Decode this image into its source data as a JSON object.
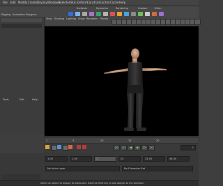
{
  "menubar": {
    "items": [
      "File",
      "Edit",
      "Modify",
      "Create",
      "Display",
      "Windows",
      "Skeleton",
      "Skin",
      "Deform",
      "Constrain",
      "Control",
      "Cache",
      "Help"
    ]
  },
  "shelf": {
    "tabs": [
      "Rigging",
      "Animation",
      "Polygons",
      "Surfaces",
      "Dynamics",
      "Rendering",
      "Custom",
      "XGen"
    ],
    "tool_colors": [
      "#2e6fd6",
      "#7ab3e6",
      "#a7a7a7",
      "#a870c8",
      "#3aa06a",
      "#b4b4b4",
      "#d9534f",
      "#e0a23b",
      "#4aa3df",
      "#8b8b8b",
      "#6bbf59",
      "#c9c9c9",
      "#d06c3a",
      "#9a6fd0"
    ]
  },
  "left_panel": {
    "labels": [
      "Tools",
      "Edit",
      "Help"
    ]
  },
  "viewport": {
    "panel_menu": [
      "View",
      "Shading",
      "Lighting",
      "Show",
      "Renderer",
      "Panels"
    ]
  },
  "timeline": {
    "current_frame": "1",
    "ticks": [
      "1",
      "5",
      "10",
      "15",
      "20"
    ],
    "start_field": "1.00",
    "end_field": "24.00"
  },
  "bottom_panel": {
    "row1": [
      "1.00",
      "1.00",
      "1",
      "24",
      "24.00",
      "48.00"
    ],
    "row2_label": "No Anim Layer",
    "row3_label": "No Character Set"
  },
  "status": {
    "help_text": "Select an object to display its attributes. Hold the Shift key to add objects to the selection."
  }
}
